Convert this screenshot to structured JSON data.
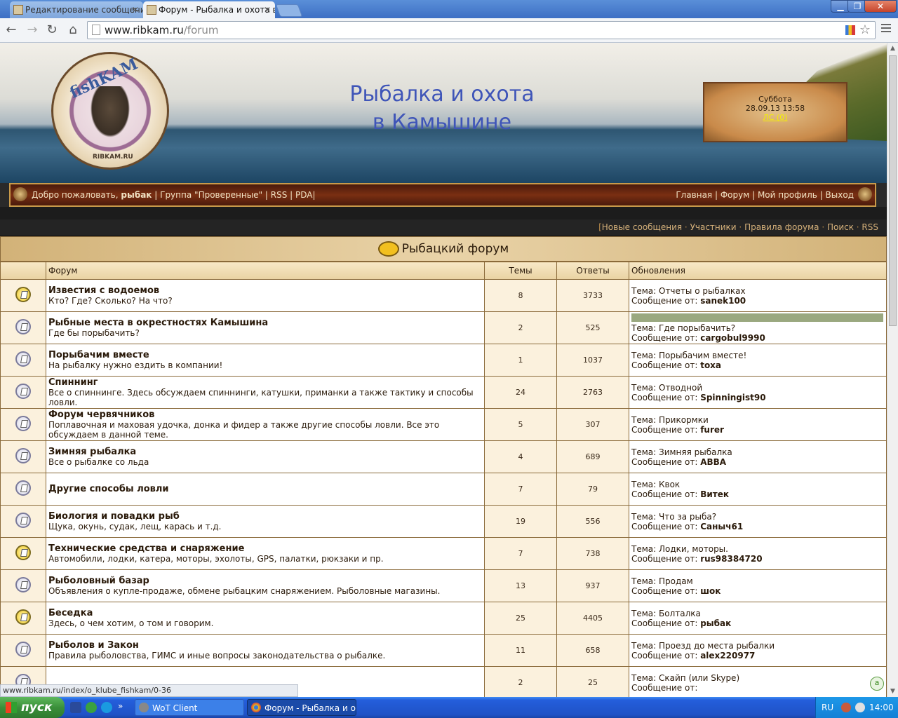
{
  "browser": {
    "tabs": [
      {
        "title": "Редактирование сообщени",
        "active": false
      },
      {
        "title": "Форум - Рыбалка и охота в",
        "active": true
      }
    ],
    "url_host": "www.ribkam.ru",
    "url_path": "/forum",
    "status_url": "www.ribkam.ru/index/o_klube_fishkam/0-36"
  },
  "header": {
    "logo_brand": "fishKAM",
    "logo_site": "RIBKAM.RU",
    "title_line1": "Рыбалка и охота",
    "title_line2": "в Камышине",
    "date_day": "Суббота",
    "date_time": "28.09.13 13:58",
    "pm_link": "ЛС (0)"
  },
  "welcome": {
    "greeting": "Добро пожаловать,",
    "username": "рыбак",
    "group_label": "Группа",
    "group_name": "Проверенные",
    "rss": "RSS",
    "pda": "PDA",
    "nav": [
      "Главная",
      "Форум",
      "Мой профиль",
      "Выход"
    ]
  },
  "forum_links": [
    "Новые сообщения",
    "Участники",
    "Правила форума",
    "Поиск",
    "RSS"
  ],
  "forum": {
    "title": "Рыбацкий форум",
    "columns": {
      "forum": "Форум",
      "topics": "Темы",
      "replies": "Ответы",
      "updates": "Обновления"
    },
    "topic_prefix": "Тема:",
    "author_prefix": "Сообщение от:",
    "rows": [
      {
        "title": "Известия с водоемов",
        "desc": "Кто? Где? Сколько? На что?",
        "topics": "8",
        "replies": "3733",
        "last_topic": "Отчеты о рыбалках",
        "author": "sanek100",
        "new": true
      },
      {
        "title": "Рыбные места в окрестностях Камышина",
        "desc": "Где бы порыбачить?",
        "topics": "2",
        "replies": "525",
        "last_topic": "Где порыбачить?",
        "author": "cargobul9990",
        "new": false
      },
      {
        "title": "Порыбачим вместе",
        "desc": "На рыбалку нужно ездить в компании!",
        "topics": "1",
        "replies": "1037",
        "last_topic": "Порыбачим вместе!",
        "author": "toxa",
        "new": false
      },
      {
        "title": "Спиннинг",
        "desc": "Все о спиннинге. Здесь обсуждаем спиннинги, катушки, приманки а также тактику и способы ловли.",
        "topics": "24",
        "replies": "2763",
        "last_topic": "Отводной",
        "author": "Spinningist90",
        "new": false
      },
      {
        "title": "Форум червячников",
        "desc": "Поплавочная и маховая удочка, донка и фидер а также другие способы ловли. Все это обсуждаем в данной теме.",
        "topics": "5",
        "replies": "307",
        "last_topic": "Прикормки",
        "author": "furer",
        "new": false
      },
      {
        "title": "Зимняя рыбалка",
        "desc": "Все о рыбалке со льда",
        "topics": "4",
        "replies": "689",
        "last_topic": "Зимняя рыбалка",
        "author": "ABBA",
        "new": false
      },
      {
        "title": "Другие способы ловли",
        "desc": "",
        "topics": "7",
        "replies": "79",
        "last_topic": "Квок",
        "author": "Витек",
        "new": false
      },
      {
        "title": "Биология и повадки рыб",
        "desc": "Щука, окунь, судак, лещ, карась и т.д.",
        "topics": "19",
        "replies": "556",
        "last_topic": "Что за рыба?",
        "author": "Саныч61",
        "new": false
      },
      {
        "title": "Технические средства и снаряжение",
        "desc": "Автомобили, лодки, катера, моторы, эхолоты, GPS, палатки, рюкзаки и пр.",
        "topics": "7",
        "replies": "738",
        "last_topic": "Лодки, моторы.",
        "author": "rus98384720",
        "new": true
      },
      {
        "title": "Рыболовный базар",
        "desc": "Объявления о купле-продаже, обмене рыбацким снаряжением. Рыболовные магазины.",
        "topics": "13",
        "replies": "937",
        "last_topic": "Продам",
        "author": "шок",
        "new": false
      },
      {
        "title": "Беседка",
        "desc": "Здесь, о чем хотим, о том и говорим.",
        "topics": "25",
        "replies": "4405",
        "last_topic": "Болталка",
        "author": "рыбак",
        "new": true
      },
      {
        "title": "Рыболов и Закон",
        "desc": "Правила рыболовства, ГИМС и иные вопросы законодательства о рыбалке.",
        "topics": "11",
        "replies": "658",
        "last_topic": "Проезд до места рыбалки",
        "author": "alex220977",
        "new": false
      },
      {
        "title": "",
        "desc": "",
        "topics": "2",
        "replies": "25",
        "last_topic": "Скайп (или Skype)",
        "author": "",
        "new": false
      }
    ]
  },
  "taskbar": {
    "start_label": "пуск",
    "buttons": [
      "WoT Client",
      "Форум - Рыбалка и о..."
    ],
    "lang": "RU",
    "clock": "14:00"
  },
  "colors": {
    "title_blue": "#3f55b8",
    "pm_yellow": "#f3f000",
    "border_brown": "#8a6a3a"
  }
}
